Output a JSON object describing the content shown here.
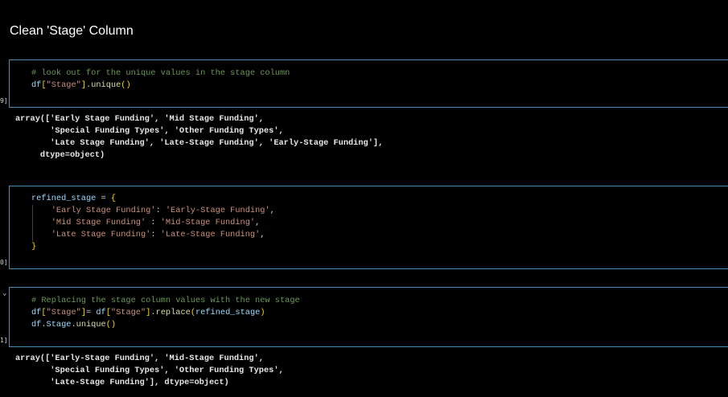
{
  "heading": "Clean 'Stage' Column",
  "cells": [
    {
      "gutter": "9]",
      "line1_comment": "# look out for the unique values in the stage column",
      "line2": {
        "var": "df",
        "br_open": "[",
        "key": "\"Stage\"",
        "br_close": "]",
        "dot": ".",
        "fn": "unique",
        "parens": "()"
      }
    },
    {
      "gutter": "0]",
      "var": "refined_stage",
      "assign": " = ",
      "brace_open": "{",
      "rows": [
        {
          "k": "'Early Stage Funding'",
          "sep": ": ",
          "v": "'Early-Stage Funding'",
          "end": ","
        },
        {
          "k": "'Mid Stage Funding'",
          "sep": " : ",
          "v": "'Mid-Stage Funding'",
          "end": ","
        },
        {
          "k": "'Late Stage Funding'",
          "sep": ": ",
          "v": "'Late-Stage Funding'",
          "end": ","
        }
      ],
      "brace_close": "}"
    },
    {
      "gutter": "1]",
      "chevron": "⌄",
      "line1_comment": "# Replacing the stage column values with the new stage",
      "line2": {
        "var": "df",
        "key": "\"Stage\"",
        "eq": "= ",
        "var2": "df",
        "key2": "\"Stage\"",
        "fn": "replace",
        "arg": "refined_stage"
      },
      "line3": {
        "var": "df",
        "dot": ".",
        "attr": "Stage",
        "dot2": ".",
        "fn": "unique",
        "parens": "()"
      }
    }
  ],
  "outputs": [
    "array(['Early Stage Funding', 'Mid Stage Funding',\n       'Special Funding Types', 'Other Funding Types',\n       'Late Stage Funding', 'Late-Stage Funding', 'Early-Stage Funding'],\n     dtype=object)",
    "array(['Early-Stage Funding', 'Mid-Stage Funding',\n       'Special Funding Types', 'Other Funding Types',\n       'Late-Stage Funding'], dtype=object)"
  ]
}
